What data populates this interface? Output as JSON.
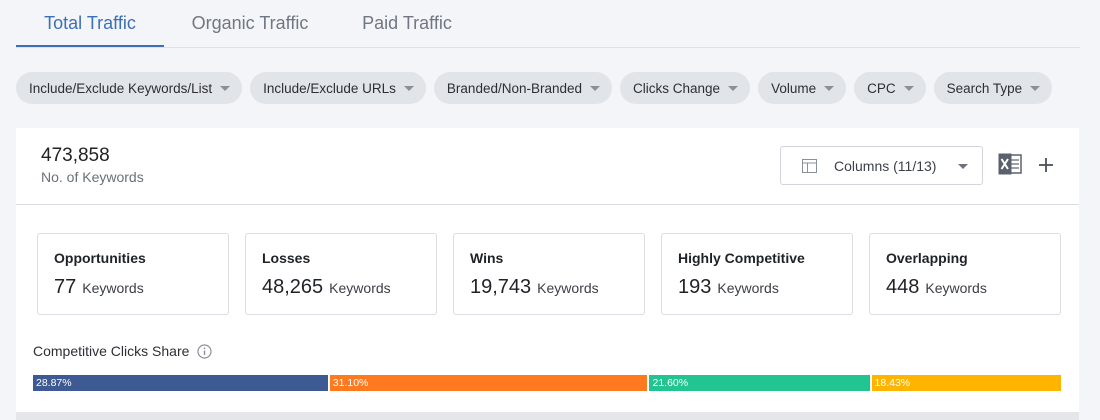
{
  "tabs": [
    {
      "label": "Total Traffic",
      "active": true
    },
    {
      "label": "Organic Traffic",
      "active": false
    },
    {
      "label": "Paid Traffic",
      "active": false
    }
  ],
  "filters": [
    "Include/Exclude Keywords/List",
    "Include/Exclude URLs",
    "Branded/Non-Branded",
    "Clicks Change",
    "Volume",
    "CPC",
    "Search Type"
  ],
  "summary": {
    "count": "473,858",
    "count_label": "No. of Keywords"
  },
  "toolbar": {
    "columns_label": "Columns (11/13)",
    "icons": [
      "table-icon",
      "excel-icon",
      "plus-icon"
    ]
  },
  "cards": [
    {
      "title": "Opportunities",
      "value": "77",
      "unit": "Keywords"
    },
    {
      "title": "Losses",
      "value": "48,265",
      "unit": "Keywords"
    },
    {
      "title": "Wins",
      "value": "19,743",
      "unit": "Keywords"
    },
    {
      "title": "Highly Competitive",
      "value": "193",
      "unit": "Keywords"
    },
    {
      "title": "Overlapping",
      "value": "448",
      "unit": "Keywords"
    }
  ],
  "share": {
    "title": "Competitive Clicks Share",
    "segments": [
      {
        "label": "28.87%",
        "value": 28.87,
        "color": "#3d5a93"
      },
      {
        "label": "31.10%",
        "value": 31.1,
        "color": "#ff7a1f"
      },
      {
        "label": "21.60%",
        "value": 21.6,
        "color": "#22c48f"
      },
      {
        "label": "18.43%",
        "value": 18.43,
        "color": "#ffb400"
      }
    ]
  },
  "colors": {
    "accent": "#3d6fb6"
  }
}
